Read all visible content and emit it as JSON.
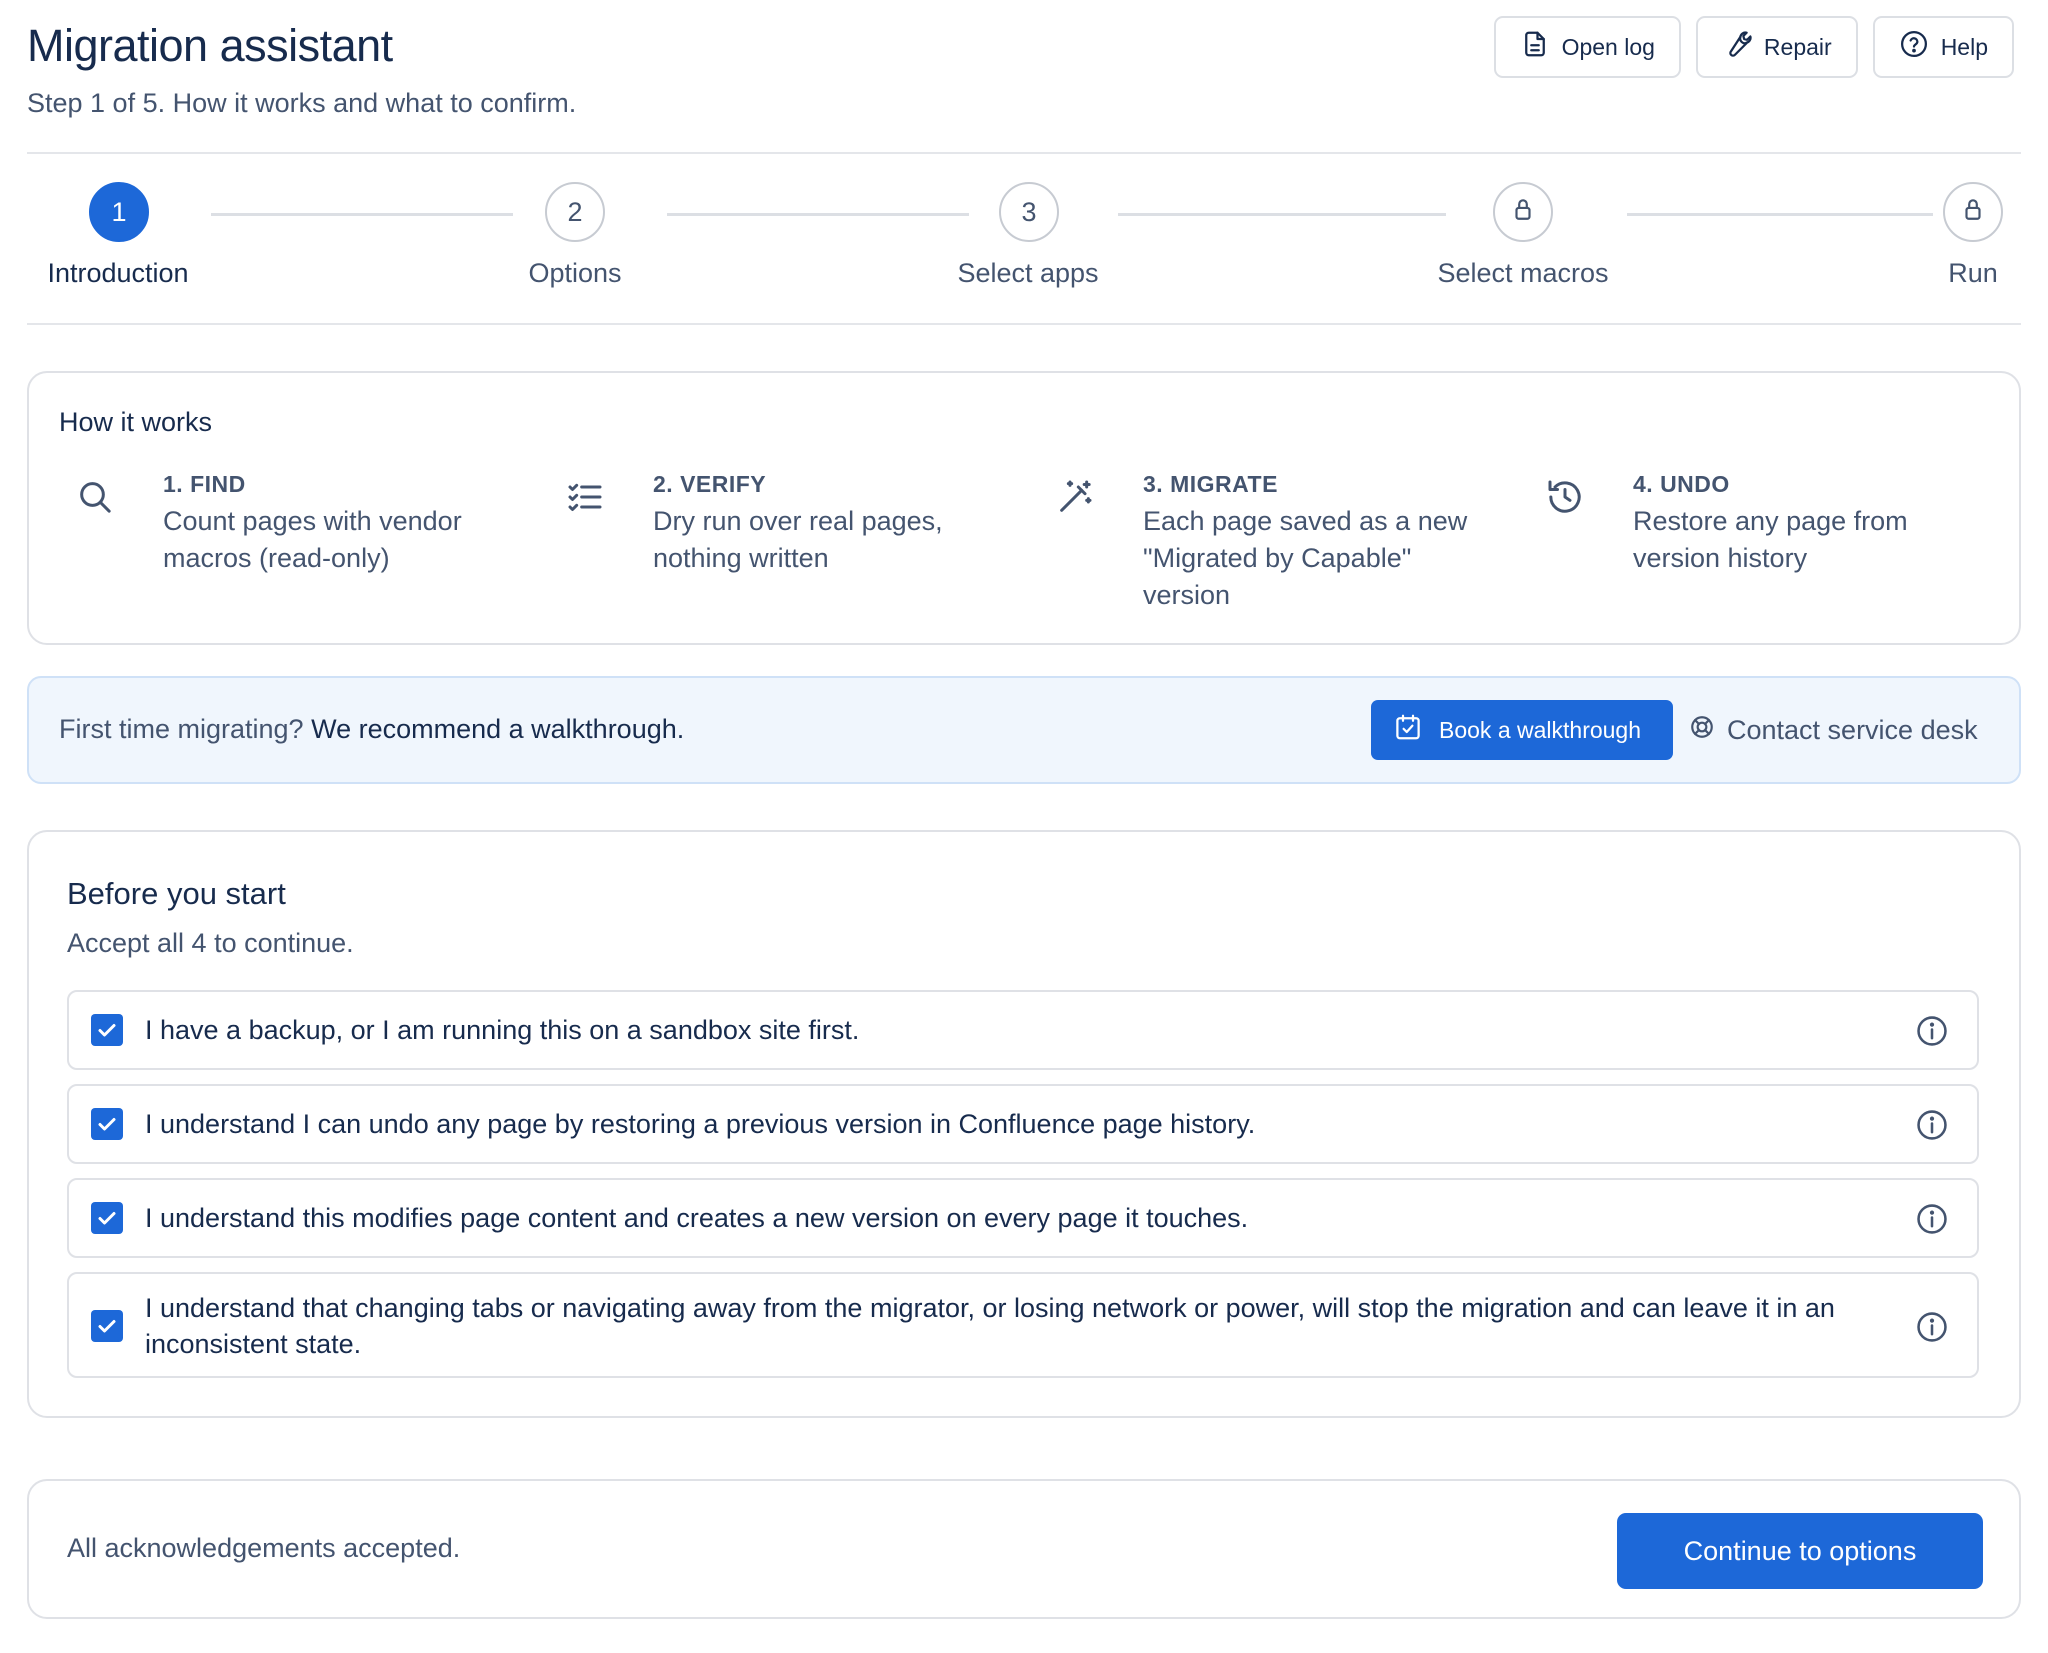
{
  "header": {
    "title": "Migration assistant",
    "subtitle": "Step 1 of 5. How it works and what to confirm.",
    "actions": [
      {
        "label": "Open log",
        "icon": "document-icon"
      },
      {
        "label": "Repair",
        "icon": "wrench-icon"
      },
      {
        "label": "Help",
        "icon": "help-icon"
      }
    ]
  },
  "stepper": {
    "steps": [
      {
        "marker": "1",
        "label": "Introduction",
        "state": "active"
      },
      {
        "marker": "2",
        "label": "Options",
        "state": "pending"
      },
      {
        "marker": "3",
        "label": "Select apps",
        "state": "pending"
      },
      {
        "marker": "lock-icon",
        "label": "Select macros",
        "state": "locked"
      },
      {
        "marker": "lock-icon",
        "label": "Run",
        "state": "locked"
      }
    ]
  },
  "how_it_works": {
    "title": "How it works",
    "items": [
      {
        "heading": "1. FIND",
        "description": "Count pages with vendor macros (read-only)",
        "icon": "search-icon"
      },
      {
        "heading": "2. VERIFY",
        "description": "Dry run over real pages, nothing written",
        "icon": "checklist-icon"
      },
      {
        "heading": "3. MIGRATE",
        "description": "Each page saved as a new \"Migrated by Capable\" version",
        "icon": "magic-wand-icon"
      },
      {
        "heading": "4. UNDO",
        "description": "Restore any page from version history",
        "icon": "history-icon"
      }
    ]
  },
  "banner": {
    "prefix": "First time migrating?",
    "emphasis": "We recommend a walkthrough.",
    "book_label": "Book a walkthrough",
    "contact_label": "Contact service desk"
  },
  "before_start": {
    "title": "Before you start",
    "subtitle": "Accept all 4 to continue.",
    "acknowledgements": [
      {
        "text": "I have a backup, or I am running this on a sandbox site first.",
        "checked": true
      },
      {
        "text": "I understand I can undo any page by restoring a previous version in Confluence page history.",
        "checked": true
      },
      {
        "text": "I understand this modifies page content and creates a new version on every page it touches.",
        "checked": true
      },
      {
        "text": "I understand that changing tabs or navigating away from the migrator, or losing network or power, will stop the migration and can leave it in an inconsistent state.",
        "checked": true
      }
    ]
  },
  "footer": {
    "status": "All acknowledgements accepted.",
    "continue_label": "Continue to options"
  },
  "colors": {
    "accent": "#1d68d8",
    "banner_bg": "#f0f6fd",
    "text": "#172b4d",
    "muted": "#44546f",
    "border": "#dfe1e6"
  }
}
